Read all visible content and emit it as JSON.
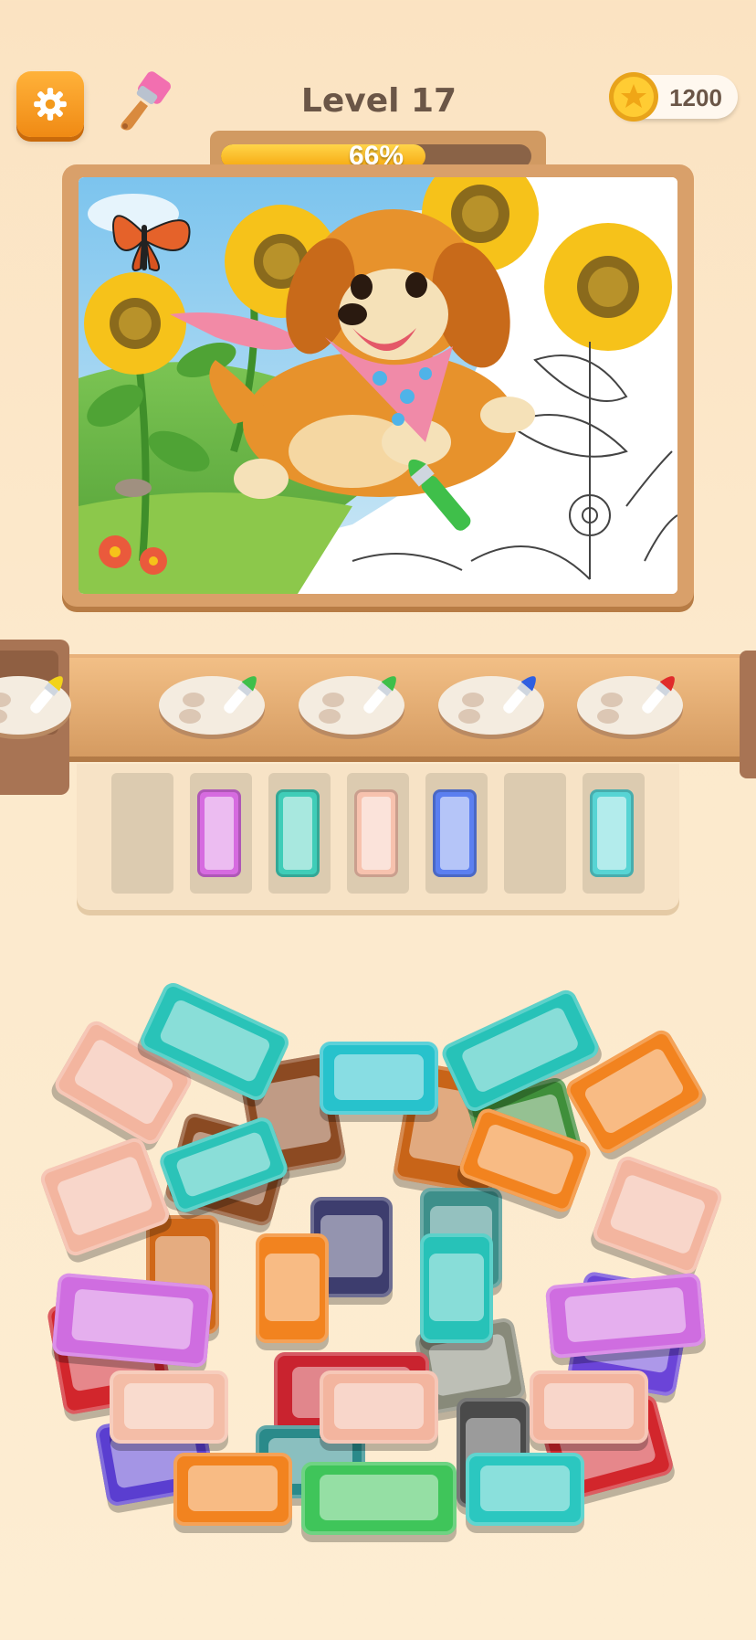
{
  "header": {
    "level_label": "Level 17",
    "coins": "1200",
    "settings_icon": "gear-icon",
    "brush_icon": "paint-brush-icon",
    "coin_icon": "star-coin-icon"
  },
  "progress": {
    "percent_text": "66%",
    "value": 0.66
  },
  "colors": {
    "accent_orange": "#f59a1e",
    "progress_fill": "#f7b51c",
    "frame": "#d9a06a"
  },
  "conveyor": {
    "palettes": [
      {
        "brush_color": "#f2d31a",
        "name": "yellow"
      },
      {
        "brush_color": "#3fbf4a",
        "name": "green"
      },
      {
        "brush_color": "#3fbf4a",
        "name": "green"
      },
      {
        "brush_color": "#2f5fe0",
        "name": "blue"
      },
      {
        "brush_color": "#e02b2b",
        "name": "red"
      }
    ]
  },
  "slots": [
    {
      "filled": false,
      "color": ""
    },
    {
      "filled": true,
      "color": "#d66be0"
    },
    {
      "filled": true,
      "color": "#3fcdb8"
    },
    {
      "filled": true,
      "color": "#f7c2ae"
    },
    {
      "filled": true,
      "color": "#5b7ff0"
    },
    {
      "filled": false,
      "color": ""
    },
    {
      "filled": true,
      "color": "#57d4d4"
    }
  ]
}
